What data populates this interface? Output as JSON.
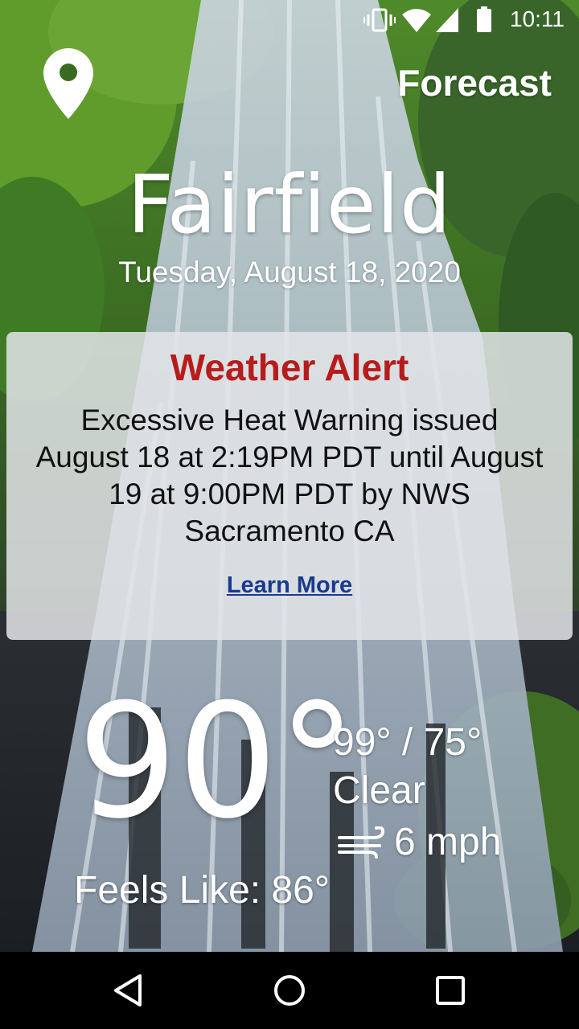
{
  "status_bar": {
    "time": "10:11",
    "icons": [
      "vibrate-icon",
      "wifi-icon",
      "signal-icon",
      "battery-icon"
    ]
  },
  "header": {
    "location_icon": "location-pin-icon",
    "forecast_label": "Forecast"
  },
  "location": {
    "city": "Fairfield",
    "date": "Tuesday, August 18, 2020"
  },
  "alert": {
    "title": "Weather Alert",
    "message": "Excessive Heat Warning issued August 18 at 2:19PM PDT until August 19 at 9:00PM PDT by NWS Sacramento CA",
    "link_label": "Learn More"
  },
  "current": {
    "temperature": "90°",
    "high_low": "99° / 75°",
    "condition": "Clear",
    "wind_icon": "wind-icon",
    "wind_speed": "6 mph",
    "feels_like": "Feels Like: 86°"
  },
  "nav_bar": {
    "buttons": [
      "back-icon",
      "home-icon",
      "recents-icon"
    ]
  },
  "colors": {
    "alert_title": "#b71c1c",
    "link": "#1a3a8c",
    "card_bg": "#e2e4e8"
  }
}
